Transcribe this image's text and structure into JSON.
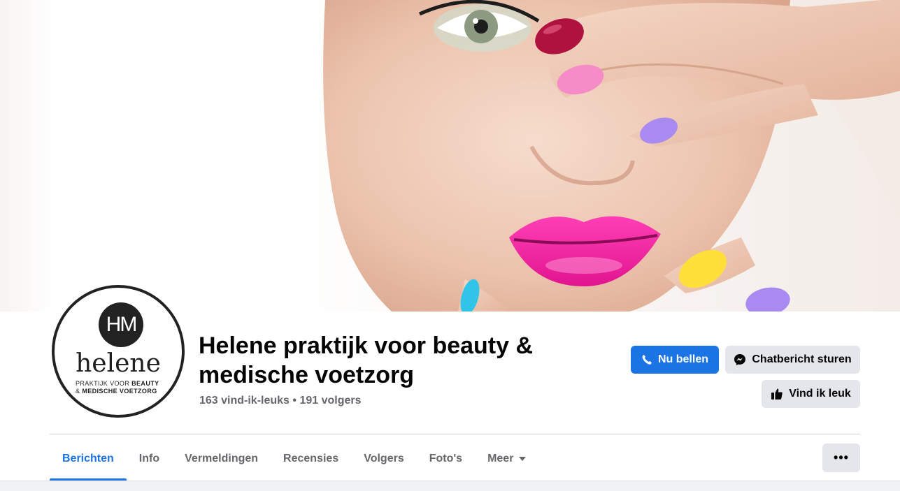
{
  "cover": {
    "image": "cover-photo-woman-colorful-nails"
  },
  "profile": {
    "logo_mark": "HM",
    "logo_word": "helene",
    "logo_sub1_a": "PRAKTIJK VOOR ",
    "logo_sub1_b": "BEAUTY",
    "logo_sub2_a": "& ",
    "logo_sub2_b": "MEDISCHE VOETZORG",
    "title": "Helene praktijk voor beauty & medische voetzorg",
    "stats": "163 vind-ik-leuks • 191 volgers"
  },
  "actions": {
    "call_label": "Nu bellen",
    "chat_label": "Chatbericht sturen",
    "like_label": "Vind ik leuk",
    "more_label": "•••"
  },
  "tabs": [
    {
      "label": "Berichten"
    },
    {
      "label": "Info"
    },
    {
      "label": "Vermeldingen"
    },
    {
      "label": "Recensies"
    },
    {
      "label": "Volgers"
    },
    {
      "label": "Foto's"
    },
    {
      "label": "Meer"
    }
  ],
  "colors": {
    "accent": "#1b74e4",
    "secondary_button": "#e4e6eb",
    "muted_text": "#65676b"
  }
}
